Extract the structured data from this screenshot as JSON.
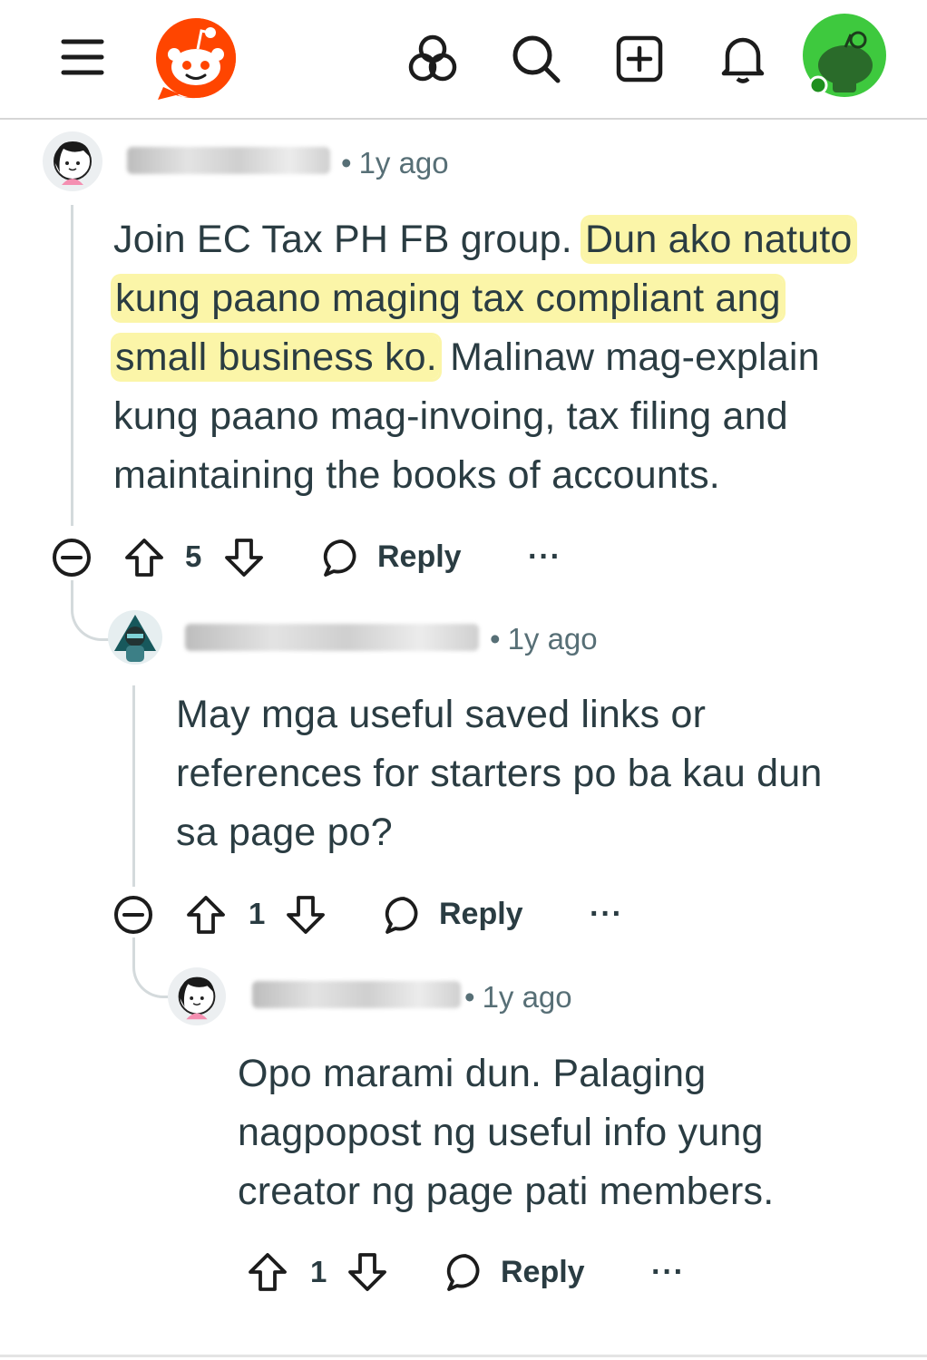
{
  "header": {
    "icons": [
      "menu-icon",
      "reddit-logo",
      "explore-icon",
      "search-icon",
      "create-post-icon",
      "notifications-icon",
      "user-avatar"
    ]
  },
  "comments": [
    {
      "timestamp": "1y ago",
      "body_prefix": "Join EC Tax PH FB group. ",
      "body_highlight_1": "Dun ako natuto",
      "body_highlight_2": "kung paano maging tax compliant ang",
      "body_highlight_3": "small business ko.",
      "body_suffix_1": " Malinaw mag-explain",
      "body_line_4": "kung paano mag-invoing, tax filing and",
      "body_line_5": "maintaining the books of accounts.",
      "score": "5",
      "reply_label": "Reply",
      "more_label": "···"
    },
    {
      "timestamp": "1y ago",
      "body_line_1": "May mga useful saved links or",
      "body_line_2": "references for starters po ba kau dun",
      "body_line_3": "sa page po?",
      "score": "1",
      "reply_label": "Reply",
      "more_label": "···"
    },
    {
      "timestamp": "1y ago",
      "body_line_1": "Opo marami dun. Palaging",
      "body_line_2": "nagpopost ng useful info yung",
      "body_line_3": "creator ng page pati members.",
      "score": "1",
      "reply_label": "Reply",
      "more_label": "···"
    }
  ],
  "colors": {
    "reddit_orange": "#ff4500",
    "highlight": "#fbf5a8",
    "meta_text": "#576f76",
    "body_text": "#2a3c42",
    "user_avatar_green": "#3ec93e"
  }
}
